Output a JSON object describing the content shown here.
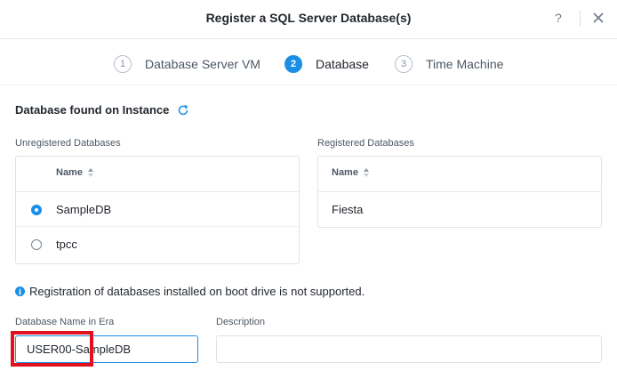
{
  "dialog": {
    "title": "Register a SQL Server Database(s)",
    "help_label": "?"
  },
  "steps": [
    {
      "number": "1",
      "label": "Database Server VM",
      "state": "inactive"
    },
    {
      "number": "2",
      "label": "Database",
      "state": "active"
    },
    {
      "number": "3",
      "label": "Time Machine",
      "state": "inactive"
    }
  ],
  "section": {
    "title": "Database found on Instance",
    "refresh_icon": "refresh-icon"
  },
  "unregistered": {
    "label": "Unregistered Databases",
    "column": "Name",
    "rows": [
      {
        "name": "SampleDB",
        "selected": true
      },
      {
        "name": "tpcc",
        "selected": false
      }
    ]
  },
  "registered": {
    "label": "Registered Databases",
    "column": "Name",
    "rows": [
      {
        "name": "Fiesta"
      }
    ]
  },
  "info": {
    "icon": "info-icon",
    "text": "Registration of databases installed on boot drive is not supported."
  },
  "form": {
    "db_name_label": "Database Name in Era",
    "db_name_value": "USER00-SampleDB",
    "description_label": "Description",
    "description_value": ""
  },
  "colors": {
    "accent": "#1b8fe6",
    "highlight": "#e0121e"
  }
}
